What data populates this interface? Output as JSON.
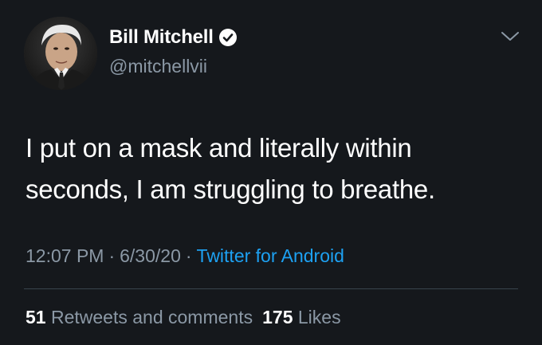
{
  "tweet": {
    "display_name": "Bill Mitchell",
    "handle": "@mitchellvii",
    "text": "I put on a mask and literally within seconds, I am struggling to breathe.",
    "time": "12:07 PM",
    "date": "6/30/20",
    "separator": "·",
    "source": "Twitter for Android",
    "retweets_count": "51",
    "retweets_label": "Retweets and comments",
    "likes_count": "175",
    "likes_label": "Likes"
  },
  "icons": {
    "verified": "verified-badge-icon",
    "menu": "chevron-down-icon"
  },
  "colors": {
    "background": "#15181c",
    "secondary_text": "#8b98a5",
    "link": "#1da1f2",
    "divider": "#38444d"
  }
}
